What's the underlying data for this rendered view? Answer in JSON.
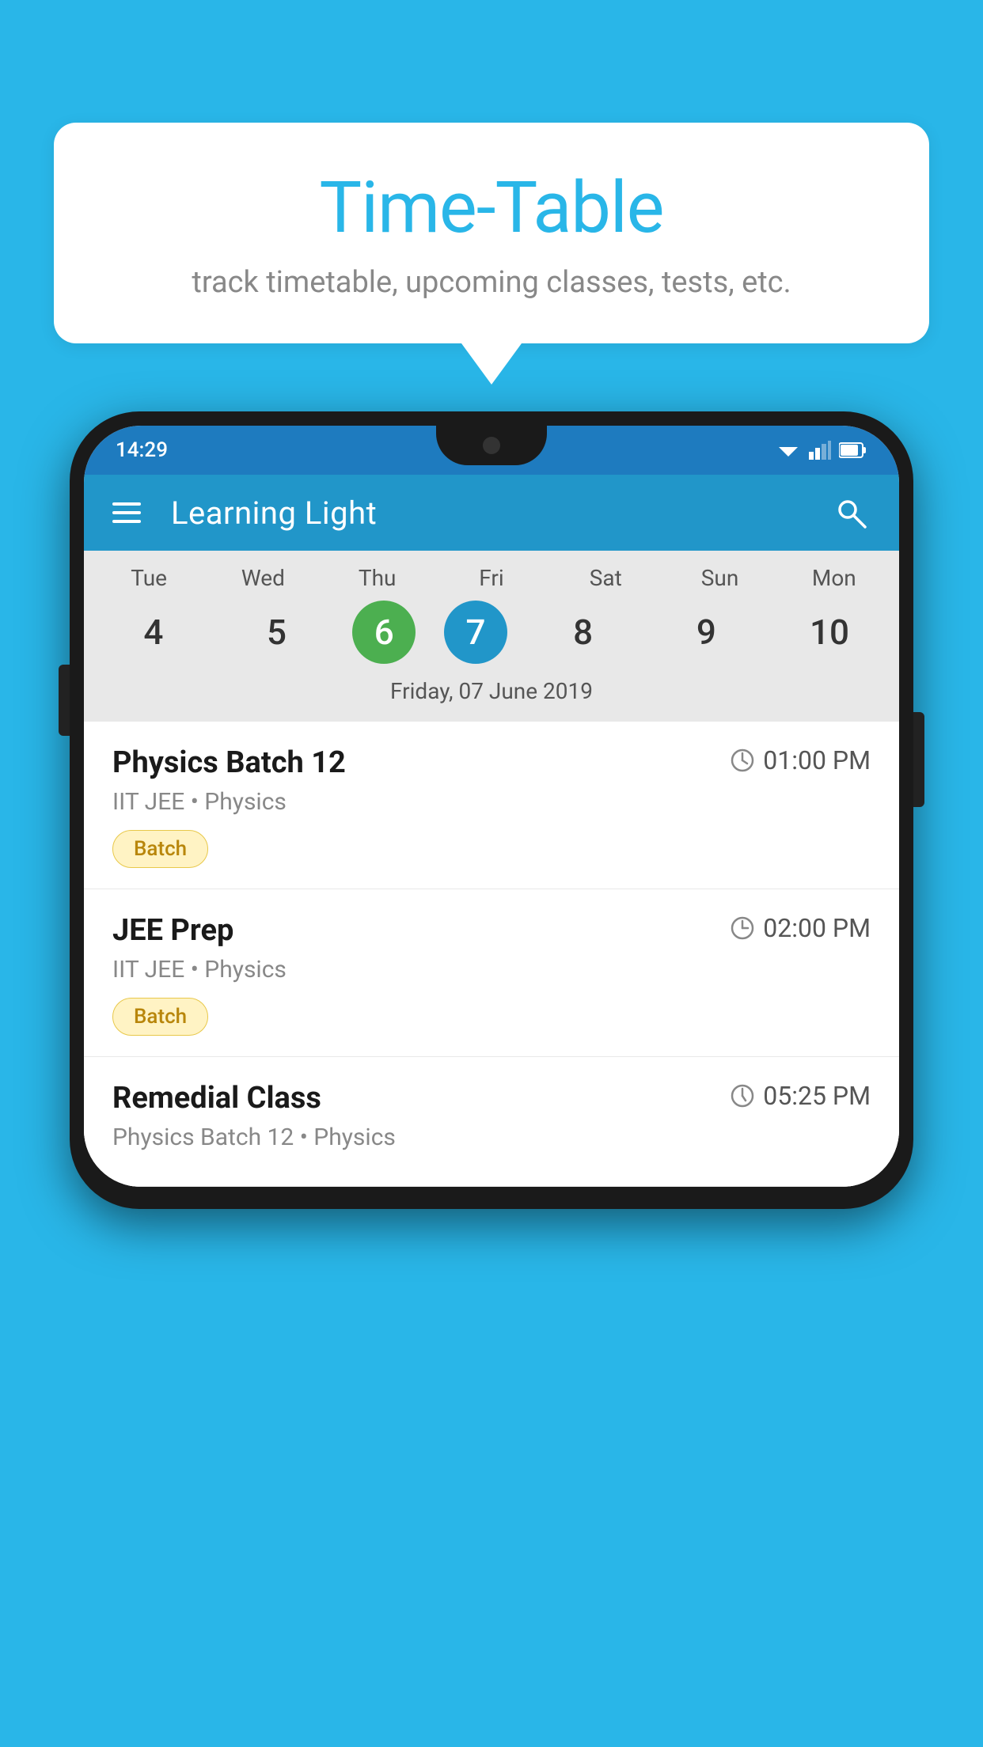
{
  "background_color": "#29b6e8",
  "bubble": {
    "title": "Time-Table",
    "subtitle": "track timetable, upcoming classes, tests, etc."
  },
  "phone": {
    "status_bar": {
      "time": "14:29"
    },
    "app_header": {
      "title": "Learning Light"
    },
    "calendar": {
      "days": [
        {
          "label": "Tue",
          "num": "4"
        },
        {
          "label": "Wed",
          "num": "5"
        },
        {
          "label": "Thu",
          "num": "6",
          "state": "today"
        },
        {
          "label": "Fri",
          "num": "7",
          "state": "selected"
        },
        {
          "label": "Sat",
          "num": "8"
        },
        {
          "label": "Sun",
          "num": "9"
        },
        {
          "label": "Mon",
          "num": "10"
        }
      ],
      "selected_date": "Friday, 07 June 2019"
    },
    "schedule": [
      {
        "title": "Physics Batch 12",
        "time": "01:00 PM",
        "subtitle": "IIT JEE • Physics",
        "badge": "Batch"
      },
      {
        "title": "JEE Prep",
        "time": "02:00 PM",
        "subtitle": "IIT JEE • Physics",
        "badge": "Batch"
      },
      {
        "title": "Remedial Class",
        "time": "05:25 PM",
        "subtitle": "Physics Batch 12 • Physics",
        "badge": null
      }
    ]
  },
  "icons": {
    "menu": "☰",
    "search": "🔍",
    "clock": "🕐"
  }
}
